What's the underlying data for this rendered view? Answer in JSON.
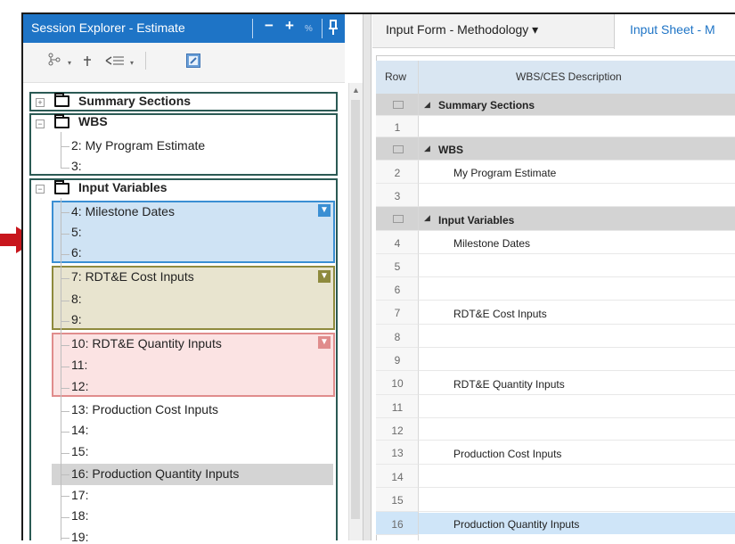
{
  "left_panel": {
    "title": "Session Explorer - Estimate",
    "header_buttons": {
      "minus": "−",
      "plus": "+",
      "percent": "%",
      "pin": "📌"
    }
  },
  "toolbar": {
    "icons": [
      "tree-view-icon",
      "sort-icon",
      "filter-icon",
      "edit-icon"
    ]
  },
  "tree": {
    "summary": "Summary Sections",
    "wbs": "WBS",
    "wbs_items": [
      "2: My Program Estimate",
      "3:"
    ],
    "input_variables": "Input Variables",
    "items": [
      "4: Milestone Dates",
      "5:",
      "6:",
      "7: RDT&E Cost Inputs",
      "8:",
      "9:",
      "10: RDT&E Quantity Inputs",
      "11:",
      "12:",
      "13: Production Cost Inputs",
      "14:",
      "15:",
      "16: Production Quantity Inputs",
      "17:",
      "18:",
      "19:"
    ],
    "group_colors": {
      "blue": "#3a8fd3",
      "olive": "#8e8a3d",
      "red": "#e08c8c"
    }
  },
  "tabs": {
    "methodology": "Input Form - Methodology ▾",
    "input_sheet": "Input Sheet - M"
  },
  "grid": {
    "headers": {
      "row": "Row",
      "description": "WBS/CES Description"
    },
    "sections": [
      "Summary Sections",
      "WBS",
      "Input Variables"
    ],
    "rows": [
      {
        "num": "1",
        "desc": ""
      },
      {
        "num": "2",
        "desc": "My Program Estimate"
      },
      {
        "num": "3",
        "desc": ""
      },
      {
        "num": "4",
        "desc": "Milestone Dates"
      },
      {
        "num": "5",
        "desc": ""
      },
      {
        "num": "6",
        "desc": ""
      },
      {
        "num": "7",
        "desc": "RDT&E Cost Inputs"
      },
      {
        "num": "8",
        "desc": ""
      },
      {
        "num": "9",
        "desc": ""
      },
      {
        "num": "10",
        "desc": "RDT&E Quantity Inputs"
      },
      {
        "num": "11",
        "desc": ""
      },
      {
        "num": "12",
        "desc": ""
      },
      {
        "num": "13",
        "desc": "Production Cost Inputs"
      },
      {
        "num": "14",
        "desc": ""
      },
      {
        "num": "15",
        "desc": ""
      },
      {
        "num": "16",
        "desc": "Production Quantity Inputs"
      }
    ]
  }
}
